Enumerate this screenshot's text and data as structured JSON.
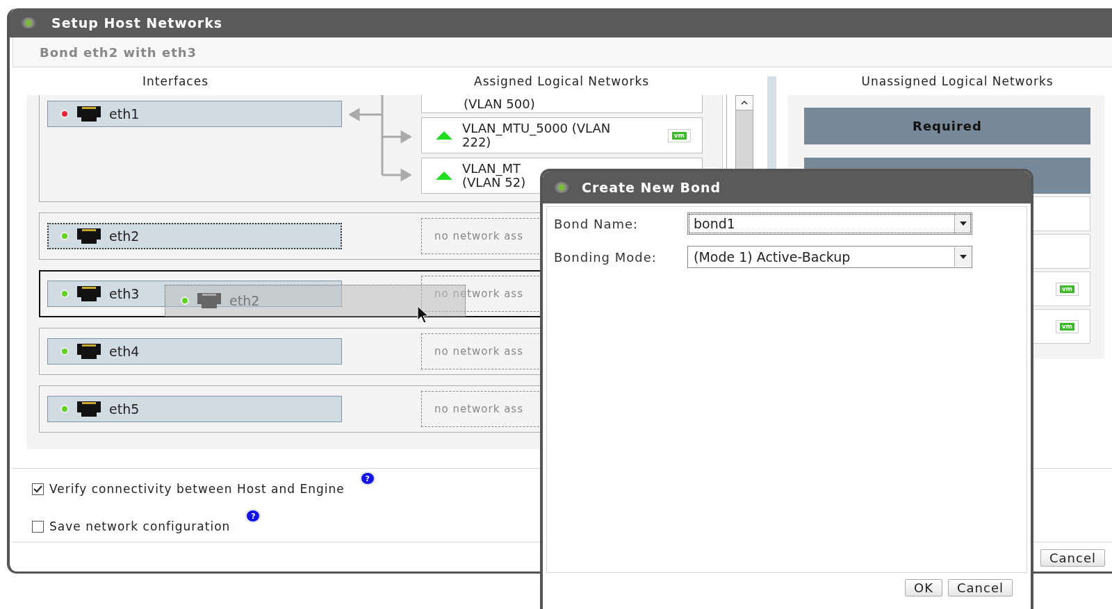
{
  "window": {
    "title": "Setup Host Networks",
    "subtitle": "Bond eth2 with eth3"
  },
  "headers": {
    "interfaces": "Interfaces",
    "assigned": "Assigned Logical Networks",
    "unassigned": "Unassigned Logical Networks"
  },
  "groups": [
    {
      "interface": {
        "name": "eth1",
        "color": "#e8263a",
        "focused": false
      },
      "drop_target": false,
      "networks": [
        {
          "kind": "partial",
          "lines": [
            "(VLAN 500)"
          ]
        },
        {
          "kind": "full",
          "color": "#22dd22",
          "lines": [
            "VLAN_MTU_5000 (VLAN",
            "222)"
          ],
          "badge": "vm"
        },
        {
          "kind": "full",
          "color": "#22dd22",
          "lines": [
            "VLAN_MT",
            "(VLAN 52)"
          ]
        }
      ]
    },
    {
      "interface": {
        "name": "eth2",
        "color": "#5fd31f",
        "focused": true
      },
      "drop_target": false,
      "placeholder": "no network ass"
    },
    {
      "interface": {
        "name": "eth3",
        "color": "#5fd31f",
        "focused": false
      },
      "drop_target": true,
      "placeholder": "no network ass"
    },
    {
      "interface": {
        "name": "eth4",
        "color": "#5fd31f",
        "focused": false
      },
      "drop_target": false,
      "placeholder": "no network ass"
    },
    {
      "interface": {
        "name": "eth5",
        "color": "#5fd31f",
        "focused": false
      },
      "drop_target": false,
      "placeholder": "no network ass"
    }
  ],
  "drag_ghost": {
    "name": "eth2",
    "color": "#5fd31f"
  },
  "unassigned": {
    "required_label": "Required",
    "items": [
      {
        "kind": "blank"
      },
      {
        "kind": "blank"
      },
      {
        "kind": "vm",
        "badge": "vm"
      },
      {
        "kind": "vm",
        "badge": "vm"
      }
    ]
  },
  "options": [
    {
      "label": "Verify connectivity between Host and Engine",
      "checked": true,
      "help": "?"
    },
    {
      "label": "Save network configuration",
      "checked": false,
      "help": "?"
    }
  ],
  "buttons": [
    "Cancel"
  ],
  "bond_dialog": {
    "title": "Create New Bond",
    "fields": [
      {
        "label": "Bond Name:",
        "value": "bond1",
        "focused": true
      },
      {
        "label": "Bonding Mode:",
        "value": "(Mode 1) Active-Backup",
        "focused": false
      }
    ],
    "buttons": [
      "OK",
      "Cancel"
    ]
  }
}
